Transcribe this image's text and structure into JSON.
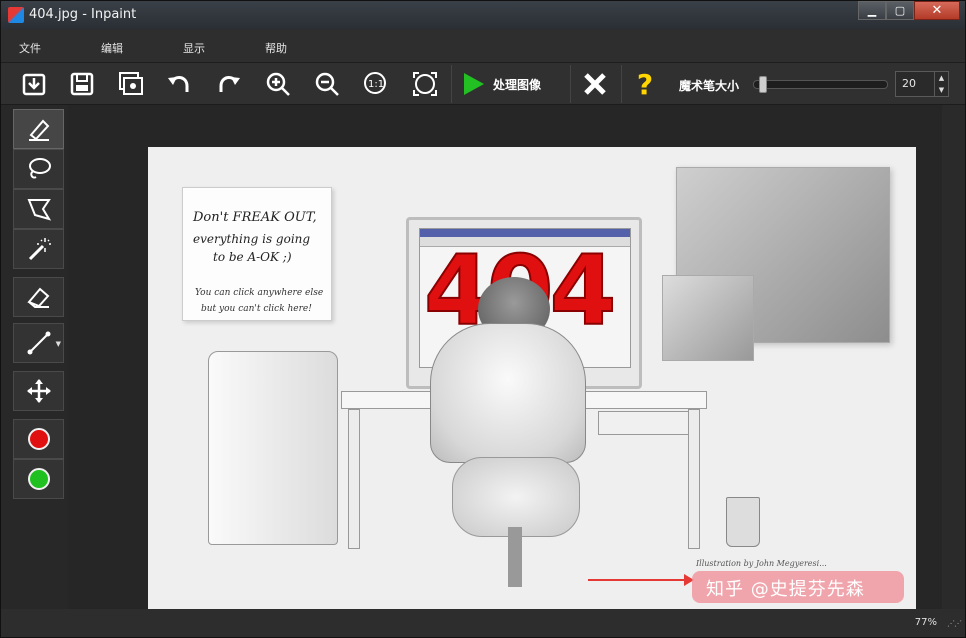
{
  "window": {
    "title": "404.jpg - Inpaint",
    "minimize_glyph": "▁",
    "maximize_glyph": "▢",
    "close_glyph": "✕"
  },
  "menu": {
    "items": [
      "文件",
      "编辑",
      "显示",
      "帮助"
    ]
  },
  "toolbar": {
    "buttons": [
      {
        "name": "open-icon"
      },
      {
        "name": "save-icon"
      },
      {
        "name": "preview-icon"
      },
      {
        "name": "undo-icon"
      },
      {
        "name": "redo-icon"
      },
      {
        "name": "zoom-in-icon"
      },
      {
        "name": "zoom-out-icon"
      },
      {
        "name": "actual-size-icon"
      },
      {
        "name": "fit-window-icon"
      }
    ],
    "process_label": "处理图像",
    "cancel_icon": "close-x-icon",
    "help_glyph": "?",
    "brush_size_label": "魔术笔大小",
    "brush_size_value": "20",
    "brush_size_fraction": 0.03
  },
  "tools": [
    {
      "name": "marker-tool",
      "active": true
    },
    {
      "name": "lasso-tool"
    },
    {
      "name": "polygon-lasso-tool"
    },
    {
      "name": "magic-wand-tool"
    },
    {
      "name": "eraser-tool"
    },
    {
      "name": "line-tool"
    },
    {
      "name": "move-tool"
    }
  ],
  "colors": {
    "red_marker": "#e01010",
    "green_marker": "#20c020"
  },
  "image": {
    "note_line1": "Don't FREAK OUT,",
    "note_line2": "everything is going",
    "note_line3": "to be A-OK ;)",
    "note_line4": "You can click anywhere else",
    "note_line5": "but you can't click here!",
    "screen_text": "404",
    "credit": "Illustration by John Megyeresi...",
    "watermark": "知乎 @史提芬先森"
  },
  "status": {
    "zoom": "77%",
    "grip": "⋰⋰"
  }
}
